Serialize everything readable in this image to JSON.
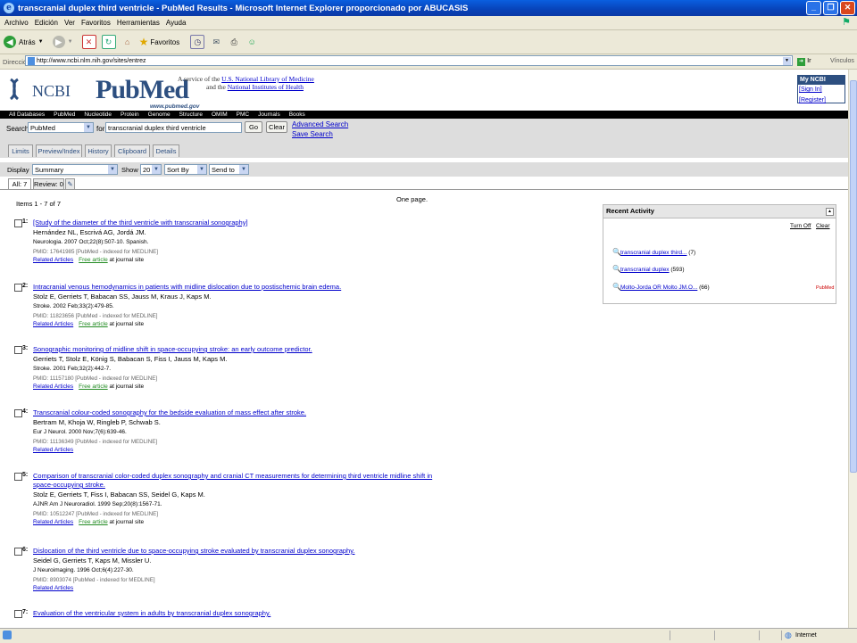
{
  "window": {
    "title": "transcranial duplex third ventricle - PubMed Results - Microsoft Internet Explorer proporcionado por ABUCASIS"
  },
  "menu": [
    "Archivo",
    "Edición",
    "Ver",
    "Favoritos",
    "Herramientas",
    "Ayuda"
  ],
  "toolbar": {
    "back_label": "Atrás",
    "favorites_label": "Favoritos"
  },
  "address": {
    "label": "Dirección",
    "url": "http://www.ncbi.nlm.nih.gov/sites/entrez",
    "go_label": "Ir",
    "links_label": "Vínculos"
  },
  "header": {
    "ncbi": "NCBI",
    "pubmed": "PubMed",
    "pubmed_url": "www.pubmed.gov",
    "service_prefix": "A service of the",
    "service_nlm": "U.S. National Library of Medicine",
    "service_mid": "and the",
    "service_nih": "National Institutes of Health",
    "myncbi": "My NCBI",
    "signin": "[Sign In]",
    "register": "[Register]"
  },
  "dbbar": [
    "All Databases",
    "PubMed",
    "Nucleotide",
    "Protein",
    "Genome",
    "Structure",
    "OMIM",
    "PMC",
    "Journals",
    "Books"
  ],
  "search": {
    "label": "Search",
    "db": "PubMed",
    "for_label": "for",
    "query": "transcranial duplex third ventricle",
    "go": "Go",
    "clear": "Clear",
    "advanced": "Advanced Search",
    "save": "Save Search"
  },
  "tabs": [
    "Limits",
    "Preview/Index",
    "History",
    "Clipboard",
    "Details"
  ],
  "display": {
    "label": "Display",
    "format": "Summary",
    "show_label": "Show",
    "show": "20",
    "sort": "Sort By",
    "send": "Send to"
  },
  "subtabs": {
    "all": "All: 7",
    "review": "Review: 0"
  },
  "results_info": {
    "items": "Items 1 - 7 of 7",
    "pages": "One page."
  },
  "results": [
    {
      "num": "1:",
      "title": "[Study of the diameter of the third ventricle with transcranial sonography]",
      "authors": "Hernández NL, Escrivá AG, Jordá JM.",
      "source": "Neurologia. 2007 Oct;22(8):507-10. Spanish.",
      "pmid": "PMID: 17641985 [PubMed - indexed for MEDLINE]",
      "related": "Related Articles",
      "free": "Free article",
      "free_suffix": "at journal site"
    },
    {
      "num": "2:",
      "title": "Intracranial venous hemodynamics in patients with midline dislocation due to postischemic brain edema.",
      "authors": "Stolz E, Gerriets T, Babacan SS, Jauss M, Kraus J, Kaps M.",
      "source": "Stroke. 2002 Feb;33(2):479-85.",
      "pmid": "PMID: 11823656 [PubMed - indexed for MEDLINE]",
      "related": "Related Articles",
      "free": "Free article",
      "free_suffix": "at journal site"
    },
    {
      "num": "3:",
      "title": "Sonographic monitoring of midline shift in space-occupying stroke: an early outcome predictor.",
      "authors": "Gerriets T, Stolz E, König S, Babacan S, Fiss I, Jauss M, Kaps M.",
      "source": "Stroke. 2001 Feb;32(2):442-7.",
      "pmid": "PMID: 11157180 [PubMed - indexed for MEDLINE]",
      "related": "Related Articles",
      "free": "Free article",
      "free_suffix": "at journal site"
    },
    {
      "num": "4:",
      "title": "Transcranial colour-coded sonography for the bedside evaluation of mass effect after stroke.",
      "authors": "Bertram M, Khoja W, Ringleb P, Schwab S.",
      "source": "Eur J Neurol. 2000 Nov;7(6):639-46.",
      "pmid": "PMID: 11136349 [PubMed - indexed for MEDLINE]",
      "related": "Related Articles",
      "free": "",
      "free_suffix": ""
    },
    {
      "num": "5:",
      "title": "Comparison of transcranial color-coded duplex sonography and cranial CT measurements for determining third ventricle midline shift in space-occupying stroke.",
      "authors": "Stolz E, Gerriets T, Fiss I, Babacan SS, Seidel G, Kaps M.",
      "source": "AJNR Am J Neuroradiol. 1999 Sep;20(8):1567-71.",
      "pmid": "PMID: 10512247 [PubMed - indexed for MEDLINE]",
      "related": "Related Articles",
      "free": "Free article",
      "free_suffix": "at journal site"
    },
    {
      "num": "6:",
      "title": "Dislocation of the third ventricle due to space-occupying stroke evaluated by transcranial duplex sonography.",
      "authors": "Seidel G, Gerriets T, Kaps M, Missler U.",
      "source": "J Neuroimaging. 1996 Oct;6(4):227-30.",
      "pmid": "PMID: 8903074 [PubMed - indexed for MEDLINE]",
      "related": "Related Articles",
      "free": "",
      "free_suffix": ""
    },
    {
      "num": "7:",
      "title": "Evaluation of the ventricular system in adults by transcranial duplex sonography.",
      "authors": "",
      "source": "",
      "pmid": "",
      "related": "",
      "free": "",
      "free_suffix": ""
    }
  ],
  "recent": {
    "title": "Recent Activity",
    "turn_off": "Turn Off",
    "clear": "Clear",
    "items": [
      {
        "query": "transcranial duplex third...",
        "count": "(7)"
      },
      {
        "query": "transcranial duplex",
        "count": "(593)"
      },
      {
        "query": "Molto-Jorda OR Molto JM.O...",
        "count": "(66)"
      }
    ],
    "db_tag": "PubMed"
  },
  "status": {
    "zone": "Internet"
  },
  "colors": {
    "link": "#0000cc",
    "free_link": "#228b22",
    "brand": "#2d4f80",
    "titlebar": "#0a4fd0"
  }
}
